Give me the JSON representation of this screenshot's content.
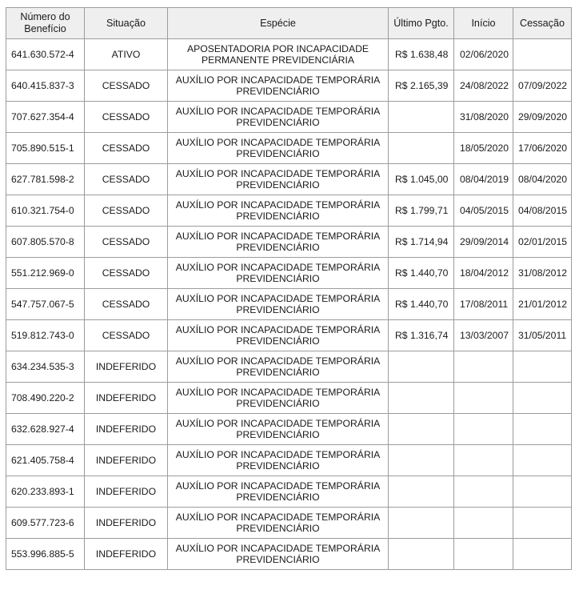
{
  "table": {
    "headers": {
      "numero": "Número do Benefício",
      "situacao": "Situação",
      "especie": "Espécie",
      "ultimo_pgto": "Último Pgto.",
      "inicio": "Início",
      "cessacao": "Cessação"
    },
    "rows": [
      {
        "numero": "641.630.572-4",
        "situacao": "ATIVO",
        "especie": "APOSENTADORIA POR INCAPACIDADE PERMANENTE PREVIDENCIÁRIA",
        "ultimo_pgto": "R$ 1.638,48",
        "inicio": "02/06/2020",
        "cessacao": ""
      },
      {
        "numero": "640.415.837-3",
        "situacao": "CESSADO",
        "especie": "AUXÍLIO POR INCAPACIDADE TEMPORÁRIA PREVIDENCIÁRIO",
        "ultimo_pgto": "R$ 2.165,39",
        "inicio": "24/08/2022",
        "cessacao": "07/09/2022"
      },
      {
        "numero": "707.627.354-4",
        "situacao": "CESSADO",
        "especie": "AUXÍLIO POR INCAPACIDADE TEMPORÁRIA PREVIDENCIÁRIO",
        "ultimo_pgto": "",
        "inicio": "31/08/2020",
        "cessacao": "29/09/2020"
      },
      {
        "numero": "705.890.515-1",
        "situacao": "CESSADO",
        "especie": "AUXÍLIO POR INCAPACIDADE TEMPORÁRIA PREVIDENCIÁRIO",
        "ultimo_pgto": "",
        "inicio": "18/05/2020",
        "cessacao": "17/06/2020"
      },
      {
        "numero": "627.781.598-2",
        "situacao": "CESSADO",
        "especie": "AUXÍLIO POR INCAPACIDADE TEMPORÁRIA PREVIDENCIÁRIO",
        "ultimo_pgto": "R$ 1.045,00",
        "inicio": "08/04/2019",
        "cessacao": "08/04/2020"
      },
      {
        "numero": "610.321.754-0",
        "situacao": "CESSADO",
        "especie": "AUXÍLIO POR INCAPACIDADE TEMPORÁRIA PREVIDENCIÁRIO",
        "ultimo_pgto": "R$ 1.799,71",
        "inicio": "04/05/2015",
        "cessacao": "04/08/2015"
      },
      {
        "numero": "607.805.570-8",
        "situacao": "CESSADO",
        "especie": "AUXÍLIO POR INCAPACIDADE TEMPORÁRIA PREVIDENCIÁRIO",
        "ultimo_pgto": "R$ 1.714,94",
        "inicio": "29/09/2014",
        "cessacao": "02/01/2015"
      },
      {
        "numero": "551.212.969-0",
        "situacao": "CESSADO",
        "especie": "AUXÍLIO POR INCAPACIDADE TEMPORÁRIA PREVIDENCIÁRIO",
        "ultimo_pgto": "R$ 1.440,70",
        "inicio": "18/04/2012",
        "cessacao": "31/08/2012"
      },
      {
        "numero": "547.757.067-5",
        "situacao": "CESSADO",
        "especie": "AUXÍLIO POR INCAPACIDADE TEMPORÁRIA PREVIDENCIÁRIO",
        "ultimo_pgto": "R$ 1.440,70",
        "inicio": "17/08/2011",
        "cessacao": "21/01/2012"
      },
      {
        "numero": "519.812.743-0",
        "situacao": "CESSADO",
        "especie": "AUXÍLIO POR INCAPACIDADE TEMPORÁRIA PREVIDENCIÁRIO",
        "ultimo_pgto": "R$ 1.316,74",
        "inicio": "13/03/2007",
        "cessacao": "31/05/2011"
      },
      {
        "numero": "634.234.535-3",
        "situacao": "INDEFERIDO",
        "especie": "AUXÍLIO POR INCAPACIDADE TEMPORÁRIA PREVIDENCIÁRIO",
        "ultimo_pgto": "",
        "inicio": "",
        "cessacao": ""
      },
      {
        "numero": "708.490.220-2",
        "situacao": "INDEFERIDO",
        "especie": "AUXÍLIO POR INCAPACIDADE TEMPORÁRIA PREVIDENCIÁRIO",
        "ultimo_pgto": "",
        "inicio": "",
        "cessacao": ""
      },
      {
        "numero": "632.628.927-4",
        "situacao": "INDEFERIDO",
        "especie": "AUXÍLIO POR INCAPACIDADE TEMPORÁRIA PREVIDENCIÁRIO",
        "ultimo_pgto": "",
        "inicio": "",
        "cessacao": ""
      },
      {
        "numero": "621.405.758-4",
        "situacao": "INDEFERIDO",
        "especie": "AUXÍLIO POR INCAPACIDADE TEMPORÁRIA PREVIDENCIÁRIO",
        "ultimo_pgto": "",
        "inicio": "",
        "cessacao": ""
      },
      {
        "numero": "620.233.893-1",
        "situacao": "INDEFERIDO",
        "especie": "AUXÍLIO POR INCAPACIDADE TEMPORÁRIA PREVIDENCIÁRIO",
        "ultimo_pgto": "",
        "inicio": "",
        "cessacao": ""
      },
      {
        "numero": "609.577.723-6",
        "situacao": "INDEFERIDO",
        "especie": "AUXÍLIO POR INCAPACIDADE TEMPORÁRIA PREVIDENCIÁRIO",
        "ultimo_pgto": "",
        "inicio": "",
        "cessacao": ""
      },
      {
        "numero": "553.996.885-5",
        "situacao": "INDEFERIDO",
        "especie": "AUXÍLIO POR INCAPACIDADE TEMPORÁRIA PREVIDENCIÁRIO",
        "ultimo_pgto": "",
        "inicio": "",
        "cessacao": ""
      }
    ]
  }
}
